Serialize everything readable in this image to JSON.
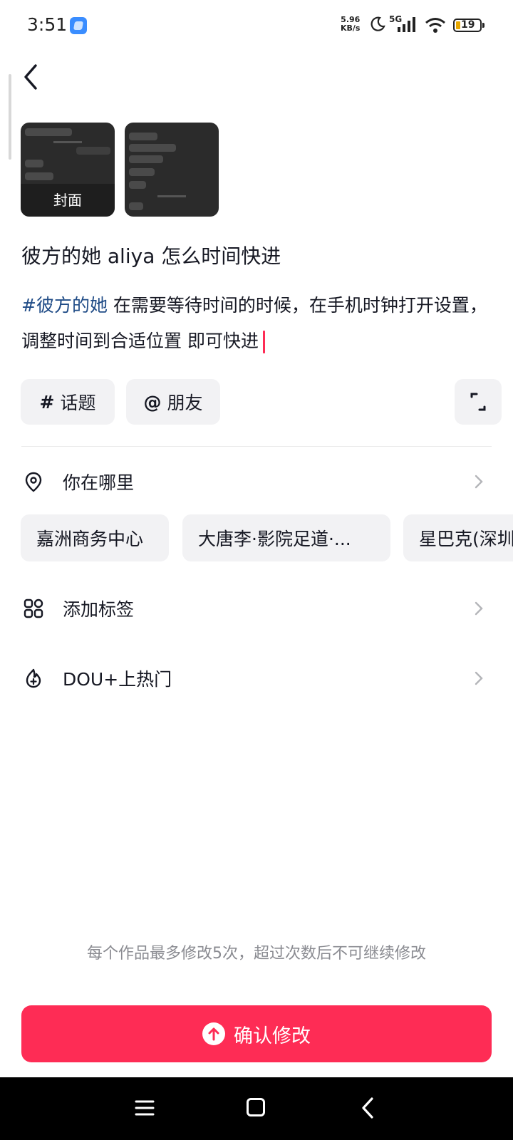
{
  "status_bar": {
    "time": "3:51",
    "net_speed_value": "5.96",
    "net_speed_unit": "KB/s",
    "network": "5G",
    "battery": "19",
    "battery_color": "#e8a800"
  },
  "header": {
    "back_icon": "chevron-left-icon"
  },
  "media": {
    "cover_label": "封面",
    "thumbnails": [
      "chat-screenshot-1",
      "chat-screenshot-2"
    ]
  },
  "post": {
    "title": "彼方的她 aliya 怎么时间快进",
    "hashtag": "#彼方的她",
    "description": " 在需要等待时间的时候，在手机时钟打开设置，调整时间到合适位置 即可快进"
  },
  "chips": {
    "topic_symbol": "#",
    "topic_label": "话题",
    "friend_symbol": "@",
    "friend_label": "朋友"
  },
  "rows": {
    "location_label": "你在哪里",
    "tags_label": "添加标签",
    "dou_label": "DOU+上热门"
  },
  "location_suggestions": [
    "嘉洲商务中心",
    "大唐李·影院足道·...",
    "星巴克(深圳"
  ],
  "footer": {
    "notice": "每个作品最多修改5次，超过次数后不可继续修改",
    "confirm_label": "确认修改"
  },
  "colors": {
    "accent": "#fe2c55",
    "hashtag": "#1f4b86",
    "chip_bg": "#f2f2f4"
  }
}
